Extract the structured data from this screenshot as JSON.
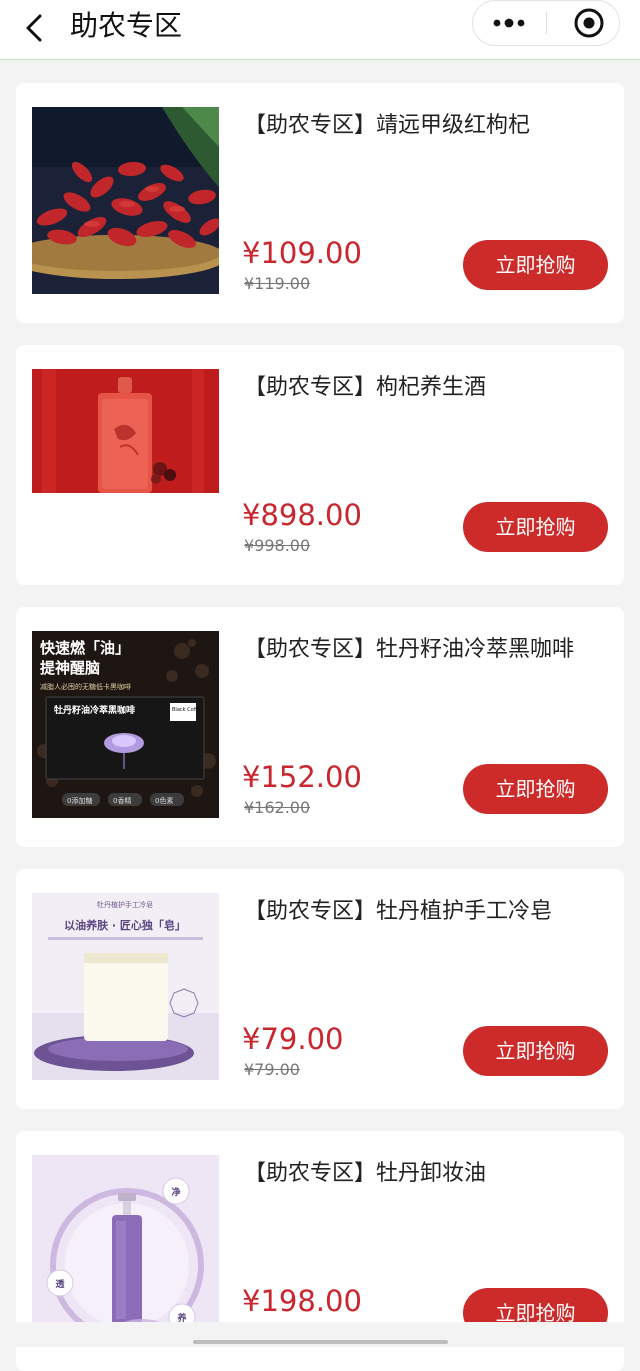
{
  "header": {
    "title": "助农专区",
    "back_icon": "chevron-left-icon",
    "more_icon": "more-dots-icon",
    "close_icon": "target-circle-icon"
  },
  "colors": {
    "price": "#c8272e",
    "button": "#cd2a2a",
    "background": "#f3f3f3"
  },
  "products": [
    {
      "name": "【助农专区】靖远甲级红枸杞",
      "price": "¥109.00",
      "original_price": "¥119.00",
      "button_label": "立即抢购",
      "image": "goji-berries-photo"
    },
    {
      "name": "【助农专区】枸杞养生酒",
      "price": "¥898.00",
      "original_price": "¥998.00",
      "button_label": "立即抢购",
      "image": "goji-wine-bottle-photo"
    },
    {
      "name": "【助农专区】牡丹籽油冷萃黑咖啡",
      "price": "¥152.00",
      "original_price": "¥162.00",
      "button_label": "立即抢购",
      "image": "black-coffee-box-photo",
      "image_text": {
        "headline_1": "快速燃「油」",
        "headline_2": "提神醒脑",
        "tagline": "减脂人必囤的无糖低卡黑咖啡",
        "box_title": "牡丹籽油冷萃黑咖啡",
        "box_badge": "Black Coffee",
        "tag_1": "0添加糖",
        "tag_2": "0香精",
        "tag_3": "0色素"
      }
    },
    {
      "name": "【助农专区】牡丹植护手工冷皂",
      "price": "¥79.00",
      "original_price": "¥79.00",
      "button_label": "立即抢购",
      "image": "handmade-soap-photo",
      "image_text": {
        "top_line": "牡丹植护手工冷皂",
        "slogan": "以油养肤 · 匠心独「皂」"
      }
    },
    {
      "name": "【助农专区】牡丹卸妆油",
      "price": "¥198.00",
      "original_price": "",
      "button_label": "立即抢购",
      "image": "cleansing-oil-photo",
      "image_text": {
        "badge_1": "净",
        "badge_2": "透",
        "badge_3": "养"
      }
    }
  ]
}
